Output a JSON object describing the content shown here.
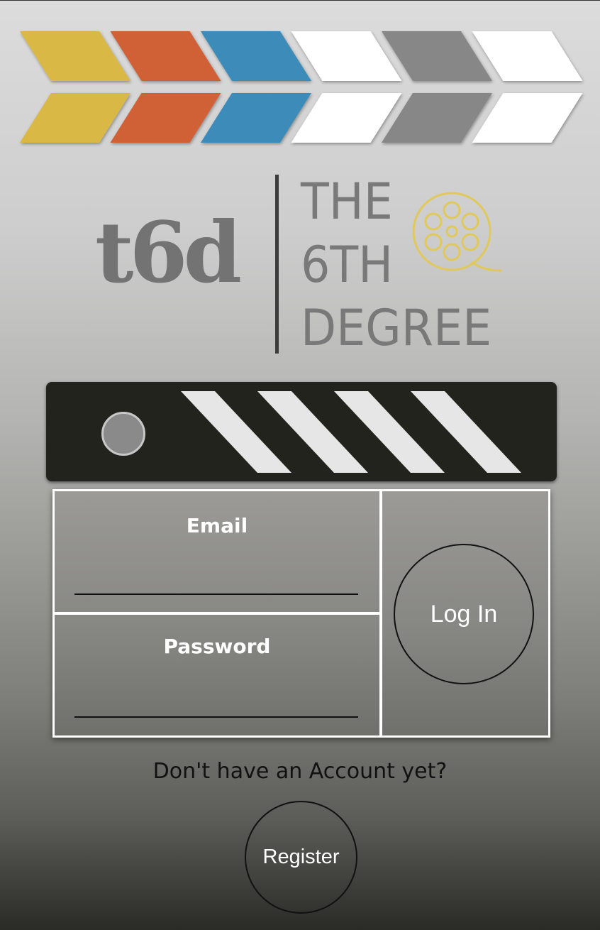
{
  "banner": {
    "chevron_colors": [
      "#d9b844",
      "#d06036",
      "#3c8bb8",
      "#ffffff",
      "#878787",
      "#ffffff"
    ]
  },
  "logo": {
    "monogram": "t6d",
    "line1": "THE",
    "line2": "6TH",
    "line3": "DEGREE",
    "reel_color": "#e0c95a"
  },
  "login_form": {
    "email_label": "Email",
    "email_value": "",
    "password_label": "Password",
    "password_value": "",
    "login_label": "Log In"
  },
  "register": {
    "prompt": "Don't have an Account yet?",
    "button_label": "Register"
  }
}
